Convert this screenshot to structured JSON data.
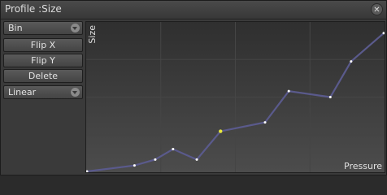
{
  "window": {
    "title": "Profile :Size",
    "close_icon": "close-icon"
  },
  "panel": {
    "mode_select": "Bin",
    "flip_x": "Flip X",
    "flip_y": "Flip Y",
    "delete": "Delete",
    "interp_select": "Linear"
  },
  "graph": {
    "ylabel": "Size",
    "xlabel": "Pressure",
    "line_color": "#5a5a8c",
    "point_color": "#ffffff",
    "selected_point_color": "#e8e83c",
    "grid_color": "#454545",
    "grid_divisions": 4
  },
  "chart_data": {
    "type": "line",
    "xlim": [
      0,
      1
    ],
    "ylim": [
      0,
      1
    ],
    "grid": true,
    "points": [
      {
        "x": 0.0,
        "y": 0.0
      },
      {
        "x": 0.16,
        "y": 0.04
      },
      {
        "x": 0.23,
        "y": 0.08
      },
      {
        "x": 0.29,
        "y": 0.15
      },
      {
        "x": 0.37,
        "y": 0.08
      },
      {
        "x": 0.45,
        "y": 0.27,
        "selected": true
      },
      {
        "x": 0.6,
        "y": 0.33
      },
      {
        "x": 0.68,
        "y": 0.54
      },
      {
        "x": 0.82,
        "y": 0.5
      },
      {
        "x": 0.89,
        "y": 0.74
      },
      {
        "x": 1.0,
        "y": 0.93
      }
    ]
  }
}
